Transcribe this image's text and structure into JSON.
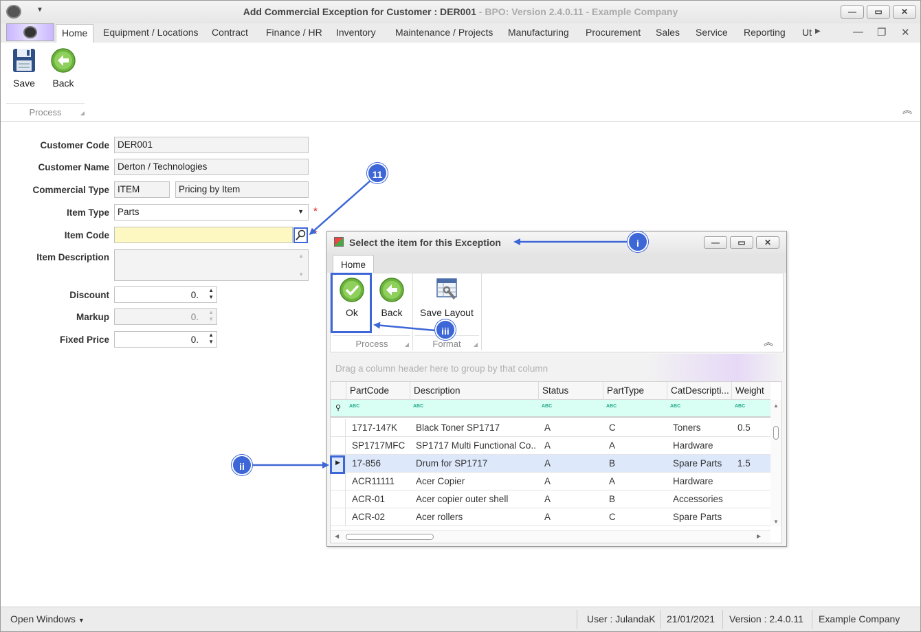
{
  "window": {
    "title_main": "Add Commercial Exception for Customer : DER001",
    "title_dim": " - BPO: Version 2.4.0.11 - Example Company"
  },
  "tabs": [
    "Home",
    "Equipment / Locations",
    "Contract",
    "Finance / HR",
    "Inventory",
    "Maintenance / Projects",
    "Manufacturing",
    "Procurement",
    "Sales",
    "Service",
    "Reporting",
    "Ut"
  ],
  "ribbon": {
    "save_label": "Save",
    "back_label": "Back",
    "group_label": "Process"
  },
  "form": {
    "customer_code_label": "Customer Code",
    "customer_code": "DER001",
    "customer_name_label": "Customer Name",
    "customer_name": "Derton / Technologies",
    "commercial_type_label": "Commercial Type",
    "commercial_type_code": "ITEM",
    "commercial_type_desc": "Pricing by Item",
    "item_type_label": "Item Type",
    "item_type": "Parts",
    "item_code_label": "Item Code",
    "item_code": "",
    "item_description_label": "Item Description",
    "discount_label": "Discount",
    "discount": "0.",
    "markup_label": "Markup",
    "markup": "0.",
    "fixed_price_label": "Fixed Price",
    "fixed_price": "0.",
    "required_mark": "*"
  },
  "dialog": {
    "title": "Select the item for this Exception",
    "tab": "Home",
    "ok_label": "Ok",
    "back_label": "Back",
    "save_layout_label": "Save Layout",
    "group_process": "Process",
    "group_format": "Format",
    "drag_hint": "Drag a column header here to group by that column",
    "columns": [
      "PartCode",
      "Description",
      "Status",
      "PartType",
      "CatDescripti...",
      "Weight"
    ],
    "filter_glyph": "ABC",
    "rows": [
      [
        "1717-147K",
        "Black Toner SP1717",
        "A",
        "C",
        "Toners",
        "0.5"
      ],
      [
        "SP1717MFC",
        "SP1717 Multi Functional Co...",
        "A",
        "A",
        "Hardware",
        ""
      ],
      [
        "17-856",
        "Drum for SP1717",
        "A",
        "B",
        "Spare Parts",
        "1.5"
      ],
      [
        "ACR11111",
        "Acer Copier",
        "A",
        "A",
        "Hardware",
        ""
      ],
      [
        "ACR-01",
        "Acer copier outer shell",
        "A",
        "B",
        "Accessories",
        ""
      ],
      [
        "ACR-02",
        "Acer rollers",
        "A",
        "C",
        "Spare Parts",
        ""
      ]
    ],
    "selected_row": 2
  },
  "annotations": {
    "step_11": "11",
    "step_i": "i",
    "step_ii": "ii",
    "step_iii": "iii"
  },
  "statusbar": {
    "open_windows": "Open Windows",
    "user": "User : JulandaK",
    "date": "21/01/2021",
    "version": "Version : 2.4.0.11",
    "company": "Example Company"
  },
  "colors": {
    "annotation_blue": "#3d66d6",
    "required_red": "#dd2222",
    "item_code_highlight": "#fdf7c2",
    "selected_row": "#dde8fb"
  }
}
